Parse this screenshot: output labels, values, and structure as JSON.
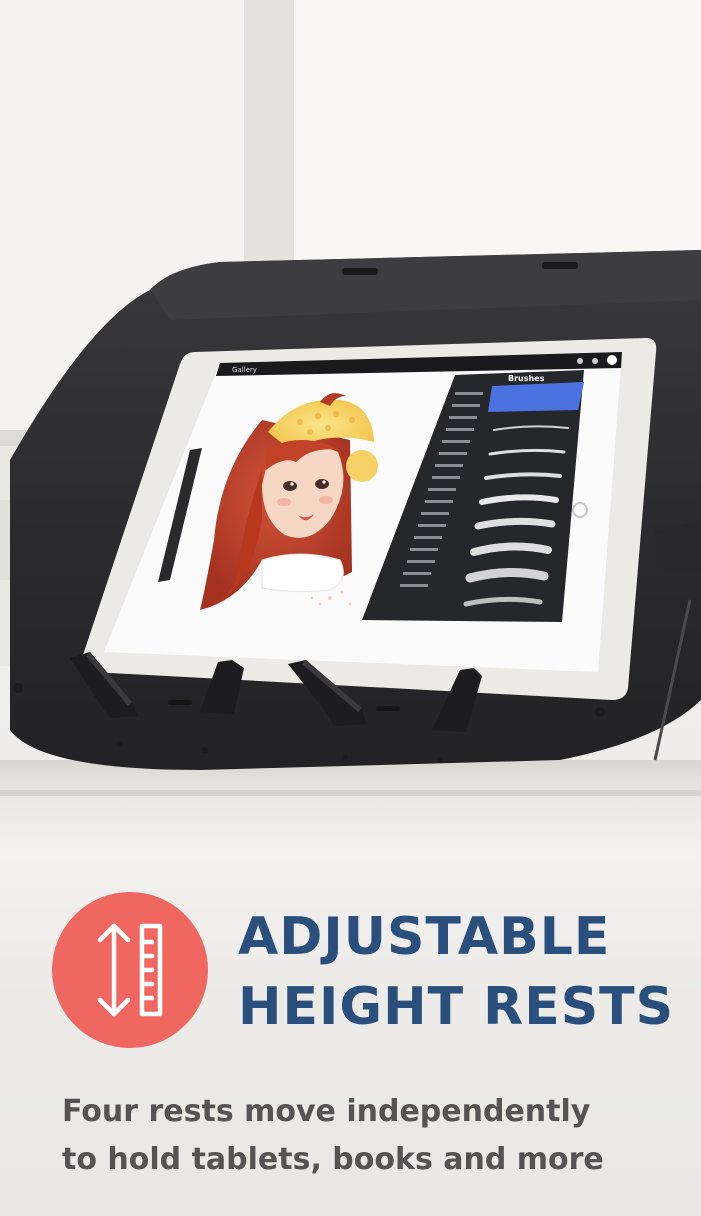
{
  "headline": {
    "line1": "ADJUSTABLE",
    "line2": "HEIGHT RESTS"
  },
  "subtext": {
    "line1": "Four rests move independently",
    "line2": "to hold tablets, books and more"
  },
  "icon": {
    "name": "height-adjust-ruler-icon"
  },
  "tablet_app": {
    "brushes_title": "Brushes",
    "gallery_label": "Gallery"
  },
  "colors": {
    "headline": "#2a4f7c",
    "subtext": "#555353",
    "badge": "#f06660",
    "stand": "#2d2d2f",
    "tablet_bezel": "#eceae6"
  }
}
